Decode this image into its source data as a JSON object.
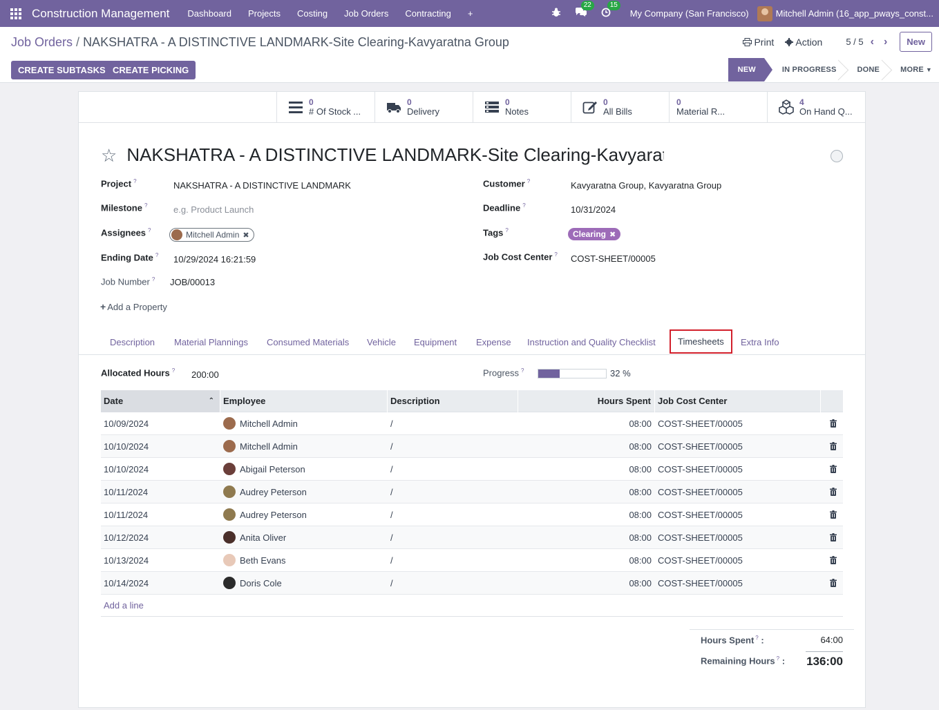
{
  "navbar": {
    "brand": "Construction Management",
    "menu": [
      "Dashboard",
      "Projects",
      "Costing",
      "Job Orders",
      "Contracting"
    ],
    "plus": "+",
    "bug_icon": "bug-icon",
    "chat_badge": "22",
    "activity_badge": "15",
    "company": "My Company (San Francisco)",
    "user": "Mitchell Admin (16_app_pways_const..."
  },
  "breadcrumb": {
    "parent": "Job Orders",
    "sep": "/",
    "current": "NAKSHATRA - A DISTINCTIVE LANDMARK-Site Clearing-Kavyaratna Group"
  },
  "actions": {
    "print": "Print",
    "action": "Action",
    "pager": "5 / 5",
    "new": "New"
  },
  "buttons": {
    "create_subtasks": "CREATE SUBTASKS",
    "create_picking": "CREATE PICKING"
  },
  "stages": {
    "new": "NEW",
    "in_progress": "IN PROGRESS",
    "done": "DONE",
    "more": "MORE"
  },
  "smart_buttons": [
    {
      "value": "0",
      "label": "# Of Stock ...",
      "icon": "list-icon"
    },
    {
      "value": "0",
      "label": "Delivery",
      "icon": "truck-icon"
    },
    {
      "value": "0",
      "label": "Notes",
      "icon": "notes-icon"
    },
    {
      "value": "0",
      "label": "All Bills",
      "icon": "edit-icon"
    },
    {
      "value": "0",
      "label": "Material R...",
      "icon": "none"
    },
    {
      "value": "4",
      "label": "On Hand Q...",
      "icon": "cubes-icon"
    }
  ],
  "form": {
    "title": "NAKSHATRA - A DISTINCTIVE LANDMARK-Site Clearing-Kavyaratna Group",
    "project_label": "Project",
    "project": "NAKSHATRA - A DISTINCTIVE LANDMARK",
    "milestone_label": "Milestone",
    "milestone_placeholder": "e.g. Product Launch",
    "assignees_label": "Assignees",
    "assignee": "Mitchell Admin",
    "ending_date_label": "Ending Date",
    "ending_date": "10/29/2024 16:21:59",
    "job_number_label": "Job Number",
    "job_number": "JOB/00013",
    "customer_label": "Customer",
    "customer": "Kavyaratna Group, Kavyaratna Group",
    "deadline_label": "Deadline",
    "deadline": "10/31/2024",
    "tags_label": "Tags",
    "tag": "Clearing",
    "cost_center_label": "Job Cost Center",
    "cost_center": "COST-SHEET/00005",
    "add_property": "Add a Property",
    "help": "?"
  },
  "tabs": [
    "Description",
    "Material Plannings",
    "Consumed Materials",
    "Vehicle",
    "Equipment",
    "Expense",
    "Instruction and Quality Checklist",
    "Timesheets",
    "Extra Info"
  ],
  "timesheet": {
    "allocated_label": "Allocated Hours",
    "allocated": "200:00",
    "progress_label": "Progress",
    "progress_percent": 32,
    "progress_text": "32 %",
    "columns": [
      "Date",
      "Employee",
      "Description",
      "Hours Spent",
      "Job Cost Center"
    ],
    "rows": [
      {
        "date": "10/09/2024",
        "employee": "Mitchell Admin",
        "description": "/",
        "hours": "08:00",
        "cost_center": "COST-SHEET/00005",
        "avatar_color": "#9c6b4d"
      },
      {
        "date": "10/10/2024",
        "employee": "Mitchell Admin",
        "description": "/",
        "hours": "08:00",
        "cost_center": "COST-SHEET/00005",
        "avatar_color": "#9c6b4d"
      },
      {
        "date": "10/10/2024",
        "employee": "Abigail Peterson",
        "description": "/",
        "hours": "08:00",
        "cost_center": "COST-SHEET/00005",
        "avatar_color": "#6b3f3a"
      },
      {
        "date": "10/11/2024",
        "employee": "Audrey Peterson",
        "description": "/",
        "hours": "08:00",
        "cost_center": "COST-SHEET/00005",
        "avatar_color": "#8f7a4f"
      },
      {
        "date": "10/11/2024",
        "employee": "Audrey Peterson",
        "description": "/",
        "hours": "08:00",
        "cost_center": "COST-SHEET/00005",
        "avatar_color": "#8f7a4f"
      },
      {
        "date": "10/12/2024",
        "employee": "Anita Oliver",
        "description": "/",
        "hours": "08:00",
        "cost_center": "COST-SHEET/00005",
        "avatar_color": "#4a2f2a"
      },
      {
        "date": "10/13/2024",
        "employee": "Beth Evans",
        "description": "/",
        "hours": "08:00",
        "cost_center": "COST-SHEET/00005",
        "avatar_color": "#e8c9b8"
      },
      {
        "date": "10/14/2024",
        "employee": "Doris Cole",
        "description": "/",
        "hours": "08:00",
        "cost_center": "COST-SHEET/00005",
        "avatar_color": "#2b2b2b"
      }
    ],
    "add_line": "Add a line",
    "hours_spent_label": "Hours Spent",
    "hours_spent": "64:00",
    "remaining_label": "Remaining Hours",
    "remaining": "136:00",
    "colon": ":"
  },
  "colors": {
    "brand": "#71639e",
    "highlight": "#d21f2b",
    "tag": "#9d6bb8"
  }
}
